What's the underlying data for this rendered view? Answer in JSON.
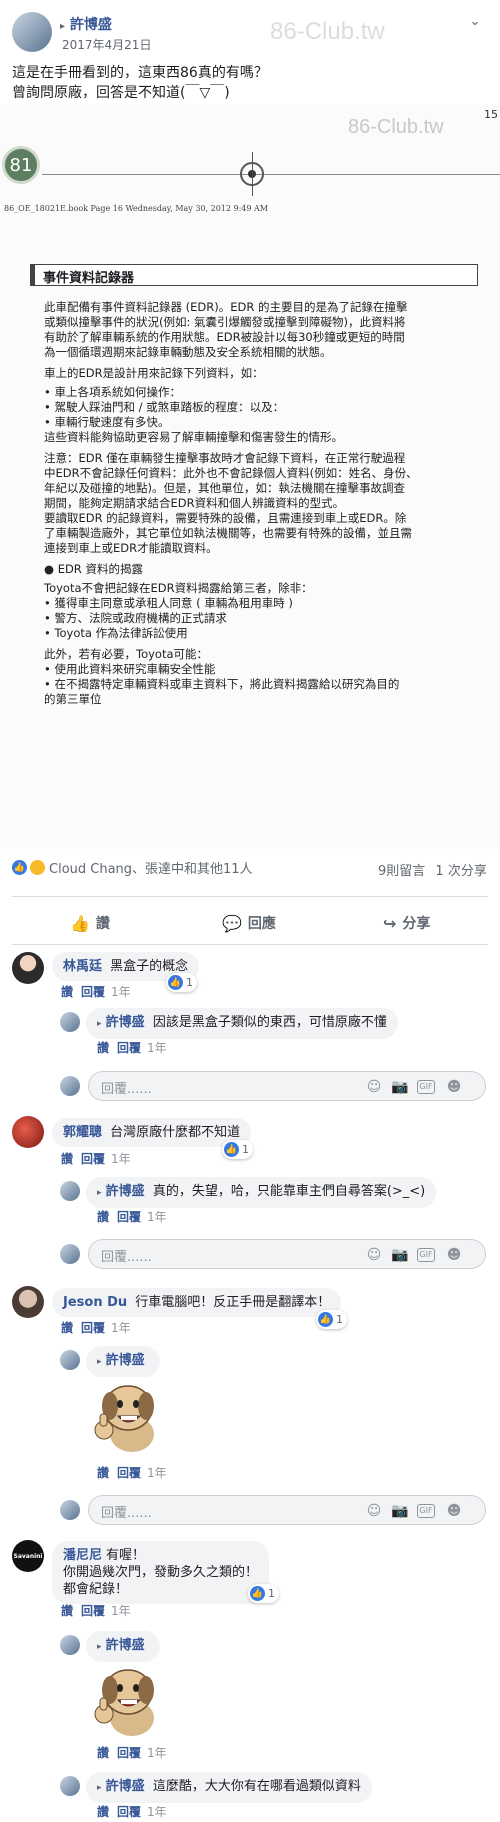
{
  "post": {
    "author": "許博盛",
    "date": "2017年4月21日",
    "text_line1": "這是在手冊看到的，這東西86真的有嗎？",
    "text_line2": "曾詢問原廠，回答是不知道(￣▽￣)"
  },
  "watermark": "86-Club.tw",
  "watermark2": "86-Club.tw",
  "doc": {
    "page_num": "15",
    "circle_num": "81",
    "header": "86_OE_18021E.book  Page 16  Wednesday, May 30, 2012  9:49 AM",
    "section_title": "事件資料記錄器",
    "lines": [
      "此車配備有事件資料記錄器 (EDR)。EDR 的主要目的是為了記錄在撞擊",
      "或類似撞擊事件的狀況(例如: 氣囊引爆觸發或撞擊到障礙物)，此資料將",
      "有助於了解車輛系統的作用狀態。EDR被設計以每30秒鐘或更短的時間",
      "為一個循環週期來記錄車輛動態及安全系統相關的狀態。",
      "車上的EDR是設計用來記錄下列資料，如：",
      "• 車上各項系統如何操作：",
      "• 駕駛人踩油門和 / 或煞車踏板的程度：以及：",
      "• 車輛行駛速度有多快。",
      "這些資料能夠協助更容易了解車輛撞擊和傷害發生的情形。",
      "注意：EDR 僅在車輛發生撞擊事故時才會記錄下資料，在正常行駛過程",
      "中EDR不會記錄任何資料：此外也不會記錄個人資料(例如：姓名、身份、",
      "年紀以及碰撞的地點)。但是，其他單位，如：執法機關在撞擊事故調查",
      "期間，能夠定期請求結合EDR資料和個人辨識資料的型式。",
      "要讀取EDR 的記錄資料，需要特殊的設備，且需連接到車上或EDR。除",
      "了車輛製造廠外，其它單位如執法機關等，也需要有特殊的設備，並且需",
      "連接到車上或EDR才能讀取資料。",
      "● EDR 資料的揭露",
      "Toyota不會把記錄在EDR資料揭露給第三者，除非：",
      "• 獲得車主同意或承租人同意 ( 車輛為租用車時 )",
      "• 警方、法院或政府機構的正式請求",
      "• Toyota 作為法律訴訟使用",
      "此外，若有必要，Toyota可能：",
      "• 使用此資料來研究車輛安全性能",
      "• 在不揭露特定車輛資料或車主資料下，將此資料揭露給以研究為目的",
      "   的第三單位"
    ]
  },
  "reactions": {
    "summary": "Cloud Chang、張達中和其他11人",
    "comments_count": "9則留言",
    "shares_count": "1 次分享",
    "like_color": "#3578e5",
    "wow_color": "#f7b928"
  },
  "actions": {
    "like": "讚",
    "comment": "回應",
    "share": "分享"
  },
  "labels": {
    "like": "讚",
    "reply": "回覆",
    "placeholder": "回覆......"
  },
  "comments": [
    {
      "name": "林禹廷",
      "text": "黑盒子的概念",
      "time": "1年",
      "likes": "1",
      "reply": {
        "name": "許博盛",
        "text": "因該是黑盒子類似的東西，可惜原廠不懂",
        "time": "1年"
      }
    },
    {
      "name": "郭耀聰",
      "text": "台灣原廠什麼都不知道",
      "time": "1年",
      "likes": "1",
      "reply": {
        "name": "許博盛",
        "text": "真的，失望，哈，只能靠車主們自尋答案(>_<)",
        "time": "1年"
      }
    },
    {
      "name": "Jeson Du",
      "text": "行車電腦吧！反正手冊是翻譯本！",
      "time": "1年",
      "likes": "1",
      "reply": {
        "name": "許博盛",
        "text": "",
        "time": "1年"
      }
    },
    {
      "name": "潘尼尼",
      "text_line1": "有喔！",
      "text_line2": "你開過幾次門，發動多久之類的！",
      "text_line3": "都會紀錄！",
      "time": "1年",
      "likes": "1",
      "avatar_text": "Savanini",
      "reply": {
        "name": "許博盛",
        "text": "",
        "time": "1年"
      },
      "reply2": {
        "name": "許博盛",
        "text": "這麼酷，大大你有在哪看過類似資料",
        "time": "1年"
      }
    }
  ]
}
